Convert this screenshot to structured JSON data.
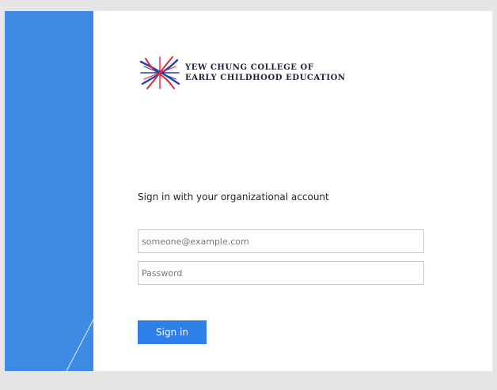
{
  "logo": {
    "line1": "YEW CHUNG COLLEGE OF",
    "line2": "EARLY CHILDHOOD EDUCATION"
  },
  "form": {
    "heading": "Sign in with your organizational account",
    "username_placeholder": "someone@example.com",
    "username_value": "",
    "password_placeholder": "Password",
    "password_value": "",
    "submit_label": "Sign in"
  },
  "colors": {
    "side_panel": "#3f8ae3",
    "button": "#2f7fe8",
    "logo_red": "#e0263a",
    "logo_blue": "#2340b0"
  }
}
